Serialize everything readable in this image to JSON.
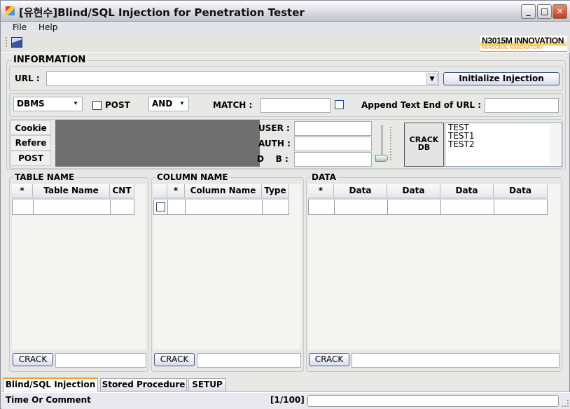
{
  "window": {
    "title": "[유현수]Blind/SQL Injection for Penetration Tester",
    "minimize": "_",
    "maximize": "□",
    "close": "✕"
  },
  "menu": [
    "File",
    "Help"
  ],
  "logo": {
    "main": "N3015M INNOVATION",
    "sub": "PERSONAL RABORATORY",
    "accent": "#ff9a00"
  },
  "information": {
    "title": "INFORMATION",
    "url_label": "URL :",
    "url_value": "",
    "init_button": "Initialize Injection",
    "dbms": "DBMS",
    "post_label": "POST",
    "post_checked": false,
    "and_or": "AND",
    "match_label": "MATCH :",
    "match_value": "",
    "append_checked": false,
    "append_label": "Append Text End of URL :",
    "append_value": "",
    "side_buttons": [
      "Cookie",
      "Refere",
      "POST"
    ],
    "user_label": "USER :",
    "auth_label": "AUTH :",
    "db_label": "D    B :",
    "user": "",
    "auth": "",
    "db": "",
    "slider_level": 0,
    "crack_db": [
      "CRACK",
      "DB"
    ],
    "db_list": [
      "TEST",
      "TEST1",
      "TEST2"
    ]
  },
  "table_panel": {
    "title": "TABLE NAME",
    "columns": [
      "*",
      "Table Name",
      "CNT"
    ],
    "crack": "CRACK",
    "value": ""
  },
  "column_panel": {
    "title": "COLUMN NAME",
    "columns": [
      "",
      "*",
      "Column Name",
      "Type"
    ],
    "crack": "CRACK",
    "value": ""
  },
  "data_panel": {
    "title": "DATA",
    "columns": [
      "*",
      "Data",
      "Data",
      "Data",
      "Data"
    ],
    "crack": "CRACK",
    "value": ""
  },
  "tabs": [
    "Blind/SQL Injection",
    "Stored Procedure",
    "SETUP"
  ],
  "status": {
    "text": "Time Or Comment",
    "page": "[1/100]",
    "progress": 0
  }
}
